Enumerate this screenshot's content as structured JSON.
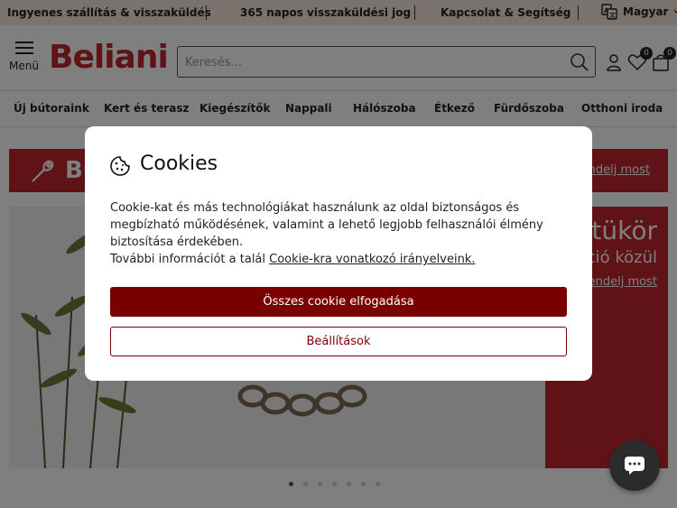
{
  "topbar": {
    "free_shipping": "Ingyenes szállítás & visszaküldés",
    "return_policy": "365 napos visszaküldési jog",
    "contact": "Kapcsolat & Segítség",
    "language": "Magyar"
  },
  "header": {
    "menu_label": "Menü",
    "logo": "Beliani",
    "search_placeholder": "Keresés...",
    "wishlist_count": "0",
    "cart_count": "0"
  },
  "nav": {
    "items": [
      "Új bútoraink",
      "Kert és terasz",
      "Kiegészítők",
      "Nappali",
      "Hálószoba",
      "Étkező",
      "Fürdőszoba",
      "Otthoni iroda"
    ]
  },
  "promo": {
    "title": "Bu",
    "link": "endelj most"
  },
  "banner": {
    "line1": "itükör",
    "line2": "ció közül",
    "link": "endelj most",
    "active_slide": 1,
    "slide_count": 7
  },
  "cookie_dialog": {
    "title": "Cookies",
    "text": "Cookie-kat és más technológiákat használunk az oldal biztonságos és megbízható működésének, valamint a lehető legjobb felhasználói élmény biztosítása érdekében.",
    "more_info": "További információt a talál",
    "policy_link": "Cookie-kra vonatkozó irányelveink.",
    "accept_label": "Összes cookie elfogadása",
    "settings_label": "Beállítások"
  },
  "colors": {
    "brand": "#c0272d",
    "accept_button": "#7a0000",
    "topbar_bg": "#f4e4d8"
  }
}
